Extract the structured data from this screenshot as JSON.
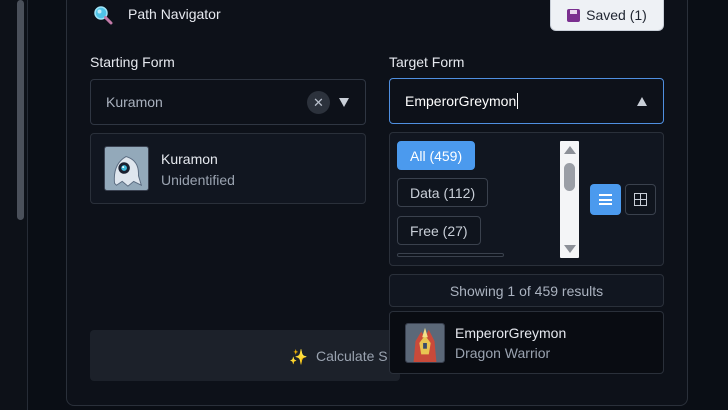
{
  "header": {
    "title": "Path Navigator",
    "saved_label": "Saved (1)"
  },
  "starting": {
    "label": "Starting Form",
    "value": "Kuramon",
    "card": {
      "name": "Kuramon",
      "attribute": "Unidentified"
    }
  },
  "target": {
    "label": "Target Form",
    "value": "EmperorGreymon"
  },
  "filters": [
    {
      "label": "All (459)",
      "active": true
    },
    {
      "label": "Data (112)",
      "active": false
    },
    {
      "label": "Free (27)",
      "active": false
    }
  ],
  "results": {
    "summary": "Showing 1 of 459 results",
    "items": [
      {
        "name": "EmperorGreymon",
        "type": "Dragon Warrior"
      }
    ]
  },
  "actions": {
    "calculate_label": "Calculate S"
  },
  "colors": {
    "accent": "#4b9aee",
    "background": "#0a0e15"
  },
  "icons": {
    "title": "search-icon",
    "saved": "floppy-disk-icon",
    "calculate": "sparkles-icon"
  }
}
